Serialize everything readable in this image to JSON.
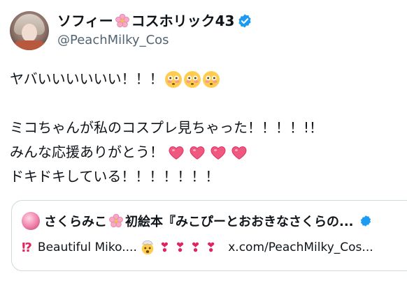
{
  "author": {
    "name_part1": "ソフィー",
    "name_part2": "コスホリック43",
    "handle": "@PeachMilky_Cos",
    "verified": true
  },
  "tweet": {
    "line1": "ヤバいいいいいい！！！",
    "line1_emojis": [
      "flushed-face",
      "flushed-face",
      "flushed-face"
    ],
    "line2": "ミコちゃんが私のコスプレ見ちゃった！！！！!！",
    "line3": "みんな応援ありがとう！",
    "line3_emojis": [
      "heart",
      "heart",
      "heart",
      "heart"
    ],
    "line4": "ドキドキしている！！！！！！！"
  },
  "quote": {
    "name_part1": "さくらみこ",
    "name_part2": "初絵本『みこぴーとおおきなさくらの...",
    "lead_glyph": "⁉",
    "text": "Beautiful Miko....",
    "exclaims": [
      "❣",
      "❣",
      "❣",
      "❣"
    ],
    "link": "x.com/PeachMilky_Cos..."
  },
  "colors": {
    "verified_blue": "#1d9bf0",
    "secondary_text": "#536471",
    "accent_pink": "#e0245e"
  }
}
